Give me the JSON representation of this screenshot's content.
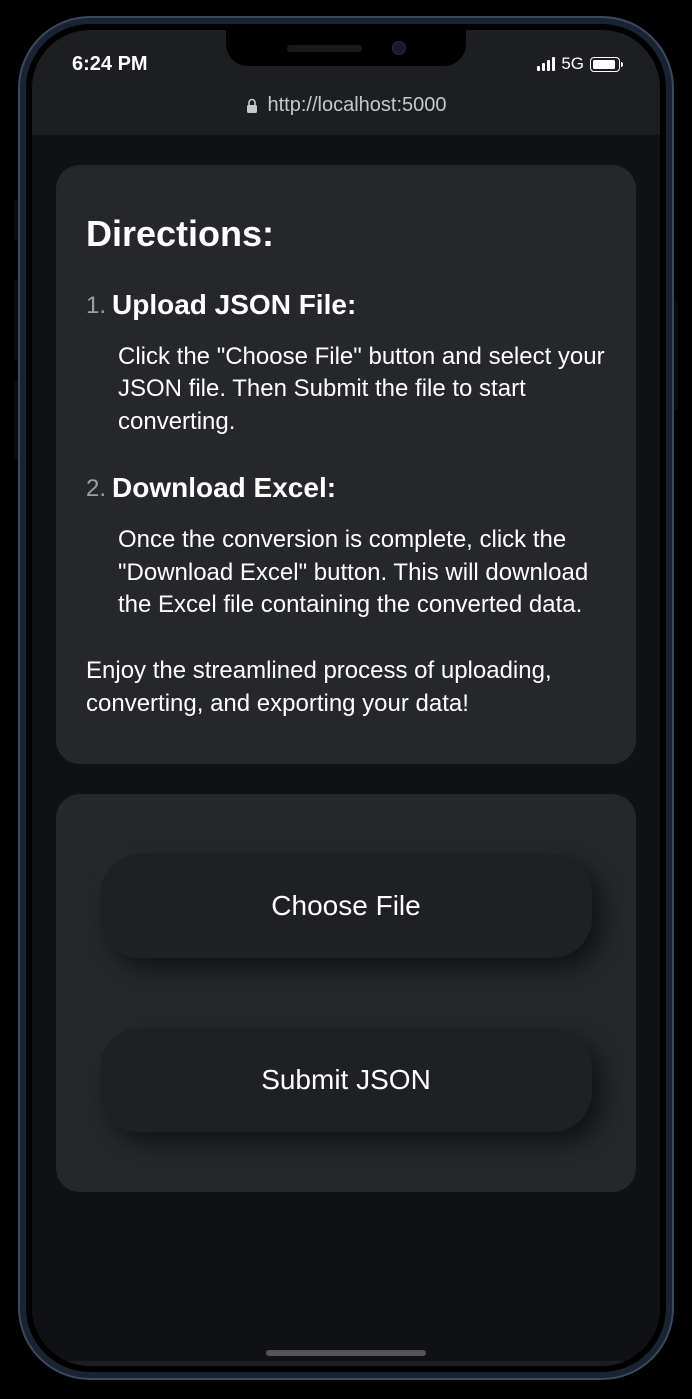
{
  "status_bar": {
    "time": "6:24 PM",
    "network": "5G"
  },
  "browser": {
    "url": "http://localhost:5000"
  },
  "directions": {
    "title": "Directions:",
    "steps": [
      {
        "num": "1.",
        "heading": "Upload JSON File:",
        "body": "Click the \"Choose File\" button and select your JSON file. Then Submit the file to start converting."
      },
      {
        "num": "2.",
        "heading": "Download Excel:",
        "body": "Once the conversion is complete, click the \"Download Excel\" button. This will download the Excel file containing the converted data."
      }
    ],
    "footer": "Enjoy the streamlined process of uploading, converting, and exporting your data!"
  },
  "actions": {
    "choose_file_label": "Choose File",
    "submit_label": "Submit JSON"
  }
}
